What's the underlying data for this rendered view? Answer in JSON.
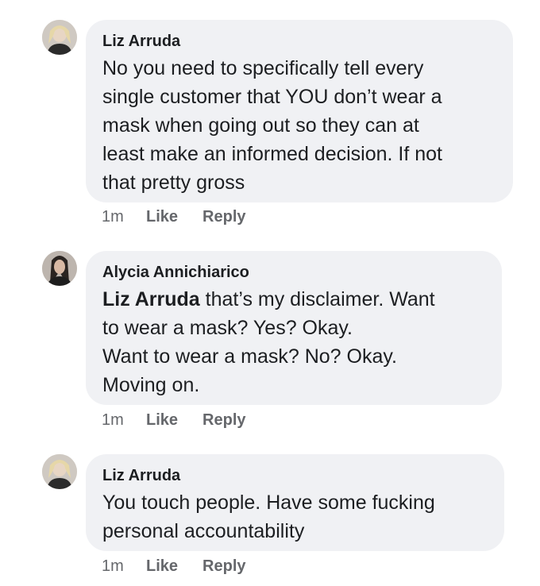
{
  "comments": [
    {
      "author": "Liz Arruda",
      "mention": "",
      "lines": [
        "No you need to specifically tell every",
        "single customer that YOU don’t wear a",
        "mask when going out so they can at",
        "least make an informed decision. If not",
        "that pretty gross"
      ],
      "time": "1m",
      "like_label": "Like",
      "reply_label": "Reply"
    },
    {
      "author": "Alycia Annichiarico",
      "mention": "Liz Arruda",
      "lines": [
        " that’s my disclaimer. Want",
        "to wear a mask? Yes? Okay.",
        "Want to wear a mask? No? Okay.",
        "Moving on."
      ],
      "time": "1m",
      "like_label": "Like",
      "reply_label": "Reply"
    },
    {
      "author": "Liz Arruda",
      "mention": "",
      "lines": [
        "You touch people. Have some fucking",
        "personal accountability"
      ],
      "time": "1m",
      "like_label": "Like",
      "reply_label": "Reply"
    }
  ]
}
